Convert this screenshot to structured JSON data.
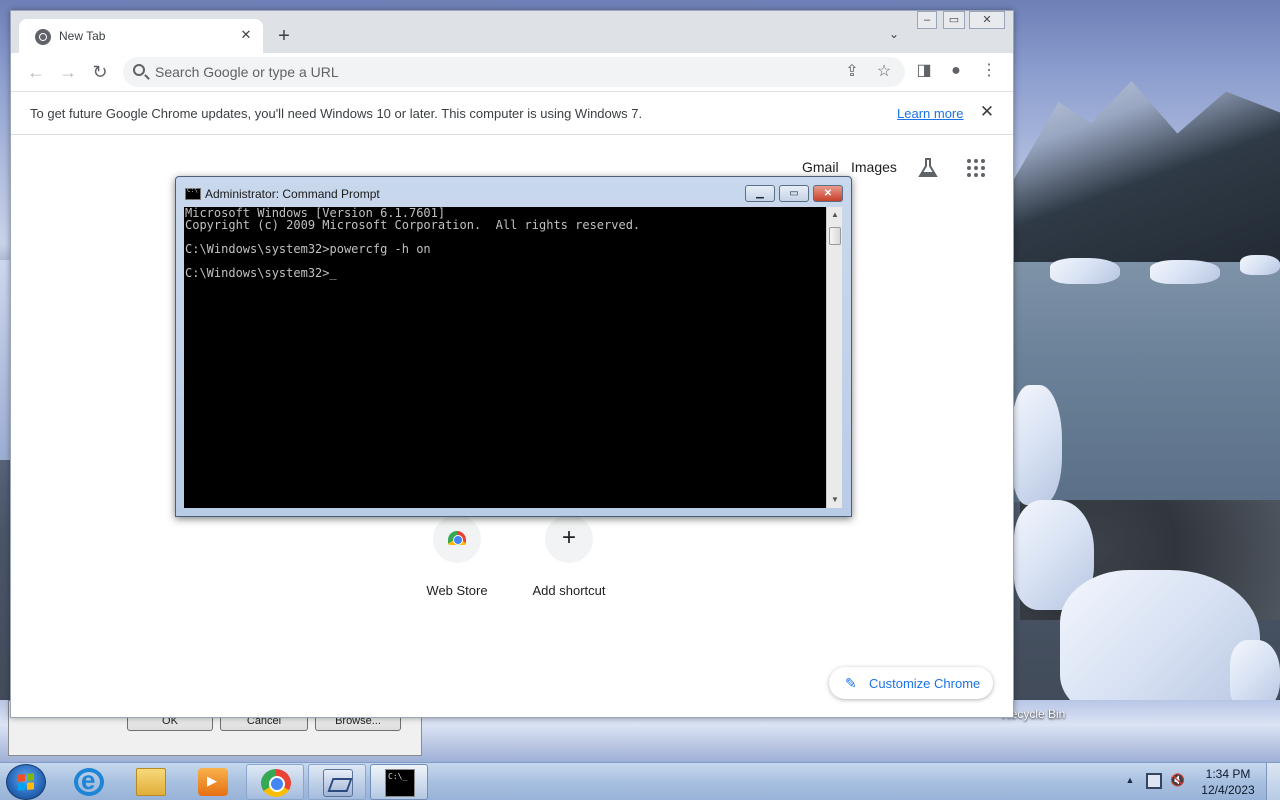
{
  "desktop": {
    "recycle_bin_label": "Recycle Bin"
  },
  "background_dialog": {
    "ok_label": "OK",
    "cancel_label": "Cancel",
    "browse_label": "Browse..."
  },
  "chrome": {
    "tab_title": "New Tab",
    "omnibox_placeholder": "Search Google or type a URL",
    "infobar": {
      "message": "To get future Google Chrome updates, you'll need Windows 10 or later. This computer is using Windows 7.",
      "learn_more": "Learn more"
    },
    "ntp": {
      "gmail": "Gmail",
      "images": "Images",
      "shortcuts": [
        {
          "label": "Web Store",
          "icon": "web-store-icon"
        },
        {
          "label": "Add shortcut",
          "icon": "plus-icon"
        }
      ],
      "customize_label": "Customize Chrome"
    }
  },
  "cmd": {
    "title": "Administrator: Command Prompt",
    "lines": [
      "Microsoft Windows [Version 6.1.7601]",
      "Copyright (c) 2009 Microsoft Corporation.  All rights reserved.",
      "",
      "C:\\Windows\\system32>powercfg -h on",
      "",
      "C:\\Windows\\system32>_"
    ]
  },
  "taskbar": {
    "apps": [
      "Internet Explorer",
      "Windows Explorer",
      "Windows Media Player",
      "Google Chrome",
      "Virtual Machine",
      "Command Prompt"
    ],
    "active_app": "Command Prompt",
    "clock_time": "1:34 PM",
    "clock_date": "12/4/2023"
  },
  "colors": {
    "accent_link": "#1a73e8",
    "console_bg": "#000000",
    "console_text": "#c0c0c0"
  }
}
